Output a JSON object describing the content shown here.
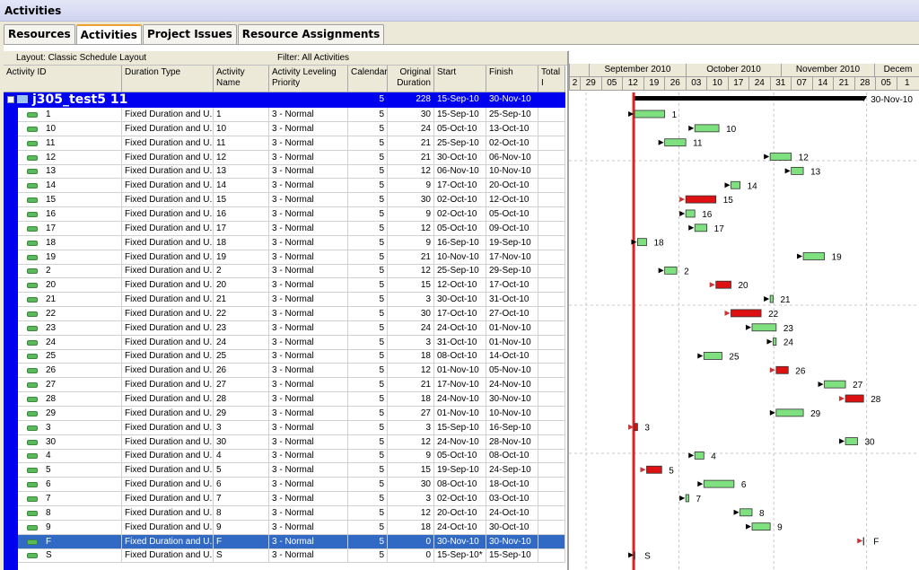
{
  "window": {
    "title": "Activities"
  },
  "tabs": [
    {
      "label": "Resources",
      "active": false
    },
    {
      "label": "Activities",
      "active": true
    },
    {
      "label": "Project Issues",
      "active": false
    },
    {
      "label": "Resource Assignments",
      "active": false
    }
  ],
  "toolbar": {
    "layout": "Layout: Classic Schedule Layout",
    "filter": "Filter: All Activities"
  },
  "columns": [
    "Activity ID",
    "Duration Type",
    "Activity Name",
    "Activity Leveling Priority",
    "Calendar",
    "Original Duration",
    "Start",
    "Finish",
    "Total I"
  ],
  "project": {
    "name": "j305_test5  11",
    "calendar": "5",
    "duration": "228",
    "start": "15-Sep-10",
    "finish": "30-Nov-10"
  },
  "activities": [
    {
      "id": "1",
      "type": "Fixed Duration and U...",
      "name": "1",
      "priority": "3 - Normal",
      "cal": "5",
      "dur": "30",
      "start": "15-Sep-10",
      "finish": "25-Sep-10",
      "critical": false
    },
    {
      "id": "10",
      "type": "Fixed Duration and U...",
      "name": "10",
      "priority": "3 - Normal",
      "cal": "5",
      "dur": "24",
      "start": "05-Oct-10",
      "finish": "13-Oct-10",
      "critical": false
    },
    {
      "id": "11",
      "type": "Fixed Duration and U...",
      "name": "11",
      "priority": "3 - Normal",
      "cal": "5",
      "dur": "21",
      "start": "25-Sep-10",
      "finish": "02-Oct-10",
      "critical": false
    },
    {
      "id": "12",
      "type": "Fixed Duration and U...",
      "name": "12",
      "priority": "3 - Normal",
      "cal": "5",
      "dur": "21",
      "start": "30-Oct-10",
      "finish": "06-Nov-10",
      "critical": false
    },
    {
      "id": "13",
      "type": "Fixed Duration and U...",
      "name": "13",
      "priority": "3 - Normal",
      "cal": "5",
      "dur": "12",
      "start": "06-Nov-10",
      "finish": "10-Nov-10",
      "critical": false
    },
    {
      "id": "14",
      "type": "Fixed Duration and U...",
      "name": "14",
      "priority": "3 - Normal",
      "cal": "5",
      "dur": "9",
      "start": "17-Oct-10",
      "finish": "20-Oct-10",
      "critical": false
    },
    {
      "id": "15",
      "type": "Fixed Duration and U...",
      "name": "15",
      "priority": "3 - Normal",
      "cal": "5",
      "dur": "30",
      "start": "02-Oct-10",
      "finish": "12-Oct-10",
      "critical": true
    },
    {
      "id": "16",
      "type": "Fixed Duration and U...",
      "name": "16",
      "priority": "3 - Normal",
      "cal": "5",
      "dur": "9",
      "start": "02-Oct-10",
      "finish": "05-Oct-10",
      "critical": false
    },
    {
      "id": "17",
      "type": "Fixed Duration and U...",
      "name": "17",
      "priority": "3 - Normal",
      "cal": "5",
      "dur": "12",
      "start": "05-Oct-10",
      "finish": "09-Oct-10",
      "critical": false
    },
    {
      "id": "18",
      "type": "Fixed Duration and U...",
      "name": "18",
      "priority": "3 - Normal",
      "cal": "5",
      "dur": "9",
      "start": "16-Sep-10",
      "finish": "19-Sep-10",
      "critical": false
    },
    {
      "id": "19",
      "type": "Fixed Duration and U...",
      "name": "19",
      "priority": "3 - Normal",
      "cal": "5",
      "dur": "21",
      "start": "10-Nov-10",
      "finish": "17-Nov-10",
      "critical": false
    },
    {
      "id": "2",
      "type": "Fixed Duration and U...",
      "name": "2",
      "priority": "3 - Normal",
      "cal": "5",
      "dur": "12",
      "start": "25-Sep-10",
      "finish": "29-Sep-10",
      "critical": false
    },
    {
      "id": "20",
      "type": "Fixed Duration and U...",
      "name": "20",
      "priority": "3 - Normal",
      "cal": "5",
      "dur": "15",
      "start": "12-Oct-10",
      "finish": "17-Oct-10",
      "critical": true
    },
    {
      "id": "21",
      "type": "Fixed Duration and U...",
      "name": "21",
      "priority": "3 - Normal",
      "cal": "5",
      "dur": "3",
      "start": "30-Oct-10",
      "finish": "31-Oct-10",
      "critical": false
    },
    {
      "id": "22",
      "type": "Fixed Duration and U...",
      "name": "22",
      "priority": "3 - Normal",
      "cal": "5",
      "dur": "30",
      "start": "17-Oct-10",
      "finish": "27-Oct-10",
      "critical": true
    },
    {
      "id": "23",
      "type": "Fixed Duration and U...",
      "name": "23",
      "priority": "3 - Normal",
      "cal": "5",
      "dur": "24",
      "start": "24-Oct-10",
      "finish": "01-Nov-10",
      "critical": false
    },
    {
      "id": "24",
      "type": "Fixed Duration and U...",
      "name": "24",
      "priority": "3 - Normal",
      "cal": "5",
      "dur": "3",
      "start": "31-Oct-10",
      "finish": "01-Nov-10",
      "critical": false
    },
    {
      "id": "25",
      "type": "Fixed Duration and U...",
      "name": "25",
      "priority": "3 - Normal",
      "cal": "5",
      "dur": "18",
      "start": "08-Oct-10",
      "finish": "14-Oct-10",
      "critical": false
    },
    {
      "id": "26",
      "type": "Fixed Duration and U...",
      "name": "26",
      "priority": "3 - Normal",
      "cal": "5",
      "dur": "12",
      "start": "01-Nov-10",
      "finish": "05-Nov-10",
      "critical": true
    },
    {
      "id": "27",
      "type": "Fixed Duration and U...",
      "name": "27",
      "priority": "3 - Normal",
      "cal": "5",
      "dur": "21",
      "start": "17-Nov-10",
      "finish": "24-Nov-10",
      "critical": false
    },
    {
      "id": "28",
      "type": "Fixed Duration and U...",
      "name": "28",
      "priority": "3 - Normal",
      "cal": "5",
      "dur": "18",
      "start": "24-Nov-10",
      "finish": "30-Nov-10",
      "critical": true
    },
    {
      "id": "29",
      "type": "Fixed Duration and U...",
      "name": "29",
      "priority": "3 - Normal",
      "cal": "5",
      "dur": "27",
      "start": "01-Nov-10",
      "finish": "10-Nov-10",
      "critical": false
    },
    {
      "id": "3",
      "type": "Fixed Duration and U...",
      "name": "3",
      "priority": "3 - Normal",
      "cal": "5",
      "dur": "3",
      "start": "15-Sep-10",
      "finish": "16-Sep-10",
      "critical": true
    },
    {
      "id": "30",
      "type": "Fixed Duration and U...",
      "name": "30",
      "priority": "3 - Normal",
      "cal": "5",
      "dur": "12",
      "start": "24-Nov-10",
      "finish": "28-Nov-10",
      "critical": false
    },
    {
      "id": "4",
      "type": "Fixed Duration and U...",
      "name": "4",
      "priority": "3 - Normal",
      "cal": "5",
      "dur": "9",
      "start": "05-Oct-10",
      "finish": "08-Oct-10",
      "critical": false
    },
    {
      "id": "5",
      "type": "Fixed Duration and U...",
      "name": "5",
      "priority": "3 - Normal",
      "cal": "5",
      "dur": "15",
      "start": "19-Sep-10",
      "finish": "24-Sep-10",
      "critical": true
    },
    {
      "id": "6",
      "type": "Fixed Duration and U...",
      "name": "6",
      "priority": "3 - Normal",
      "cal": "5",
      "dur": "30",
      "start": "08-Oct-10",
      "finish": "18-Oct-10",
      "critical": false
    },
    {
      "id": "7",
      "type": "Fixed Duration and U...",
      "name": "7",
      "priority": "3 - Normal",
      "cal": "5",
      "dur": "3",
      "start": "02-Oct-10",
      "finish": "03-Oct-10",
      "critical": false
    },
    {
      "id": "8",
      "type": "Fixed Duration and U...",
      "name": "8",
      "priority": "3 - Normal",
      "cal": "5",
      "dur": "12",
      "start": "20-Oct-10",
      "finish": "24-Oct-10",
      "critical": false
    },
    {
      "id": "9",
      "type": "Fixed Duration and U...",
      "name": "9",
      "priority": "3 - Normal",
      "cal": "5",
      "dur": "18",
      "start": "24-Oct-10",
      "finish": "30-Oct-10",
      "critical": false
    },
    {
      "id": "F",
      "type": "Fixed Duration and U...",
      "name": "F",
      "priority": "3 - Normal",
      "cal": "5",
      "dur": "0",
      "start": "30-Nov-10",
      "finish": "30-Nov-10",
      "critical": true,
      "selected": true
    },
    {
      "id": "S",
      "type": "Fixed Duration and U...",
      "name": "S",
      "priority": "3 - Normal",
      "cal": "5",
      "dur": "0",
      "start": "15-Sep-10*",
      "finish": "15-Sep-10",
      "critical": false
    }
  ],
  "gantt": {
    "months": [
      "",
      "September 2010",
      "October 2010",
      "November 2010",
      "Decem"
    ],
    "weeks": [
      "2",
      "29",
      "05",
      "12",
      "19",
      "26",
      "03",
      "10",
      "17",
      "24",
      "31",
      "07",
      "14",
      "21",
      "28",
      "05",
      "1"
    ],
    "project_finish_label": "30-Nov-10",
    "colors": {
      "normal": "#7ee07e",
      "critical": "#dd1111",
      "data_date": "#dd2222",
      "summary": "#000000"
    }
  }
}
